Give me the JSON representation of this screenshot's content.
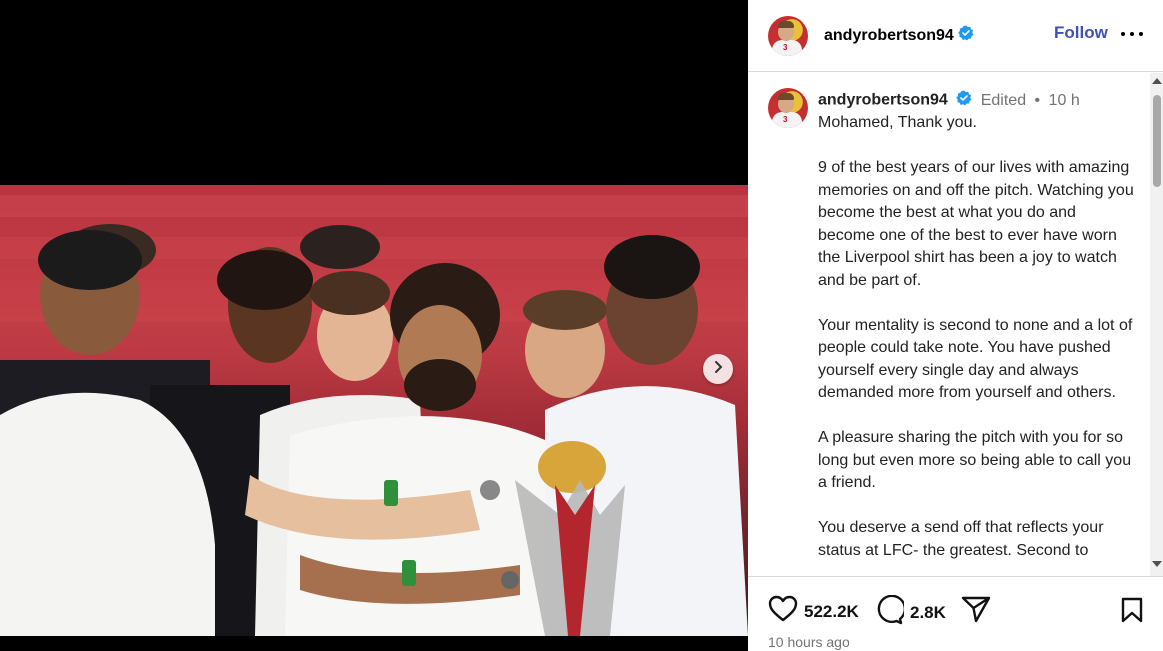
{
  "post": {
    "username": "andyrobertson94",
    "follow_label": "Follow",
    "more_icon": "more-options-icon",
    "media_icon": "chevron-right-icon"
  },
  "caption": {
    "username": "andyrobertson94",
    "edited": "Edited",
    "separator": "•",
    "age": "10 h",
    "text": "Mohamed, Thank you.\n\n9 of the best years of our lives with amazing memories on and off the pitch. Watching you become the best at what you do and become one of the best to ever have worn the Liverpool shirt has been a joy to watch and be part of.\n\nYour mentality is second to none and a lot of people could take note. You have pushed yourself every single day and always demanded more from yourself and others.\n\nA pleasure sharing the pitch with you for so long but even more so being able to call you a friend.\n\nYou deserve a send off that reflects your status at LFC- the greatest. Second to"
  },
  "actions": {
    "likes": "522.2K",
    "comments": "2.8K",
    "timestamp": "10 hours ago"
  },
  "colors": {
    "follow": "#3f51b5",
    "verified": "#1d9bf0",
    "muted": "#737373"
  }
}
